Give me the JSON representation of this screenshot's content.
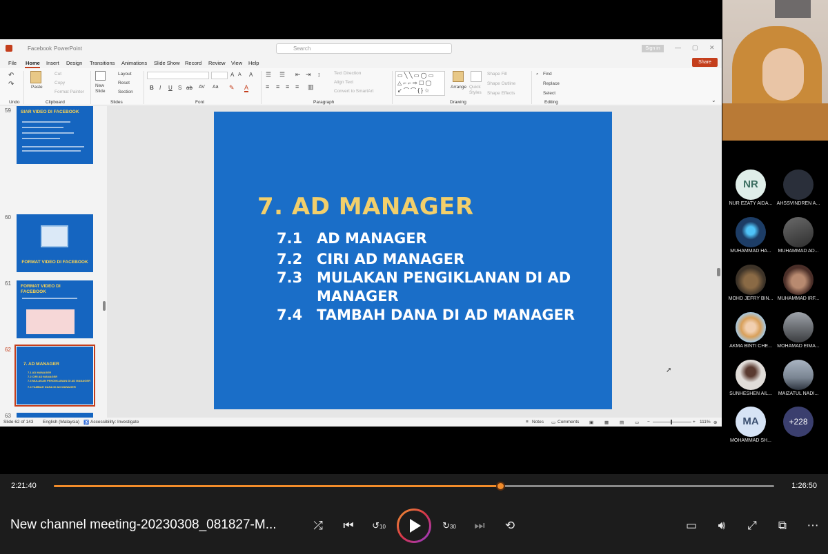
{
  "ppt": {
    "app": "PowerPoint",
    "file_name": "Facebook",
    "search_placeholder": "Search",
    "sign_in": "Sign in",
    "share": "Share",
    "menu": [
      "File",
      "Home",
      "Insert",
      "Design",
      "Transitions",
      "Animations",
      "Slide Show",
      "Record",
      "Review",
      "View",
      "Help"
    ],
    "ribbon": {
      "undo": "Undo",
      "clipboard": "Clipboard",
      "paste": "Paste",
      "cut": "Cut",
      "copy": "Copy",
      "format_painter": "Format Painter",
      "slides": "Slides",
      "new_slide": "New Slide",
      "layout": "Layout",
      "reset": "Reset",
      "section": "Section",
      "font": "Font",
      "paragraph": "Paragraph",
      "text_direction": "Text Direction",
      "align_text": "Align Text",
      "convert_smartart": "Convert to SmartArt",
      "drawing": "Drawing",
      "arrange": "Arrange",
      "quick_styles": "Quick Styles",
      "shape_fill": "Shape Fill",
      "shape_outline": "Shape Outline",
      "shape_effects": "Shape Effects",
      "editing": "Editing",
      "find": "Find",
      "replace": "Replace",
      "select": "Select"
    },
    "thumbnails": [
      {
        "num": "59",
        "title": "SIAR VIDEO DI FACEBOOK"
      },
      {
        "num": "60",
        "title": "FORMAT VIDEO DI FACEBOOK"
      },
      {
        "num": "61",
        "title": "FORMAT VIDEO DI FACEBOOK"
      },
      {
        "num": "62",
        "title": "7. AD MANAGER",
        "items": [
          "7.1    AD MANAGER",
          "7.2    CIRI AD MANAGER",
          "7.3    MULAKAN PENGIKLANAN DI AD MANAGER",
          "7.4    TAMBAH DANA DI AD MANAGER"
        ]
      },
      {
        "num": "63",
        "title": ""
      }
    ],
    "slide": {
      "title": "7. AD MANAGER",
      "items": [
        {
          "num": "7.1",
          "text": "AD MANAGER"
        },
        {
          "num": "7.2",
          "text": "CIRI AD MANAGER"
        },
        {
          "num": "7.3",
          "text": "MULAKAN PENGIKLANAN DI AD",
          "text2": "MANAGER"
        },
        {
          "num": "7.4",
          "text": "TAMBAH DANA DI AD MANAGER"
        }
      ]
    },
    "status": {
      "slide_count": "Slide 62 of 143",
      "language": "English (Malaysia)",
      "accessibility": "Accessibility: Investigate",
      "notes": "Notes",
      "comments": "Comments",
      "zoom": "111%"
    }
  },
  "participants": [
    {
      "initials": "NR",
      "name": "NUR EZATY AIDA...",
      "color": "#dfeee9"
    },
    {
      "initials": "",
      "name": "AHSSVINDREN A...",
      "color": "#2a2f3a"
    },
    {
      "initials": "",
      "name": "MUHAMMAD HA...",
      "color": "#1d3d66"
    },
    {
      "initials": "",
      "name": "MUHAMMAD AD...",
      "color": "#4a4a4a"
    },
    {
      "initials": "",
      "name": "MOHD JEFRY BIN...",
      "color": "#6b5a3a"
    },
    {
      "initials": "",
      "name": "MUHAMMAD IRF...",
      "color": "#5a3d33"
    },
    {
      "initials": "",
      "name": "AKMA BINTI CHE...",
      "color": "#d9a05a"
    },
    {
      "initials": "",
      "name": "MOHAMAD EIMA...",
      "color": "#5b5e63"
    },
    {
      "initials": "",
      "name": "SUNHESHEN A/L...",
      "color": "#b3aaa4"
    },
    {
      "initials": "",
      "name": "MAIZATUL NADI...",
      "color": "#7a8592"
    },
    {
      "initials": "MA",
      "name": "MOHAMMAD SH...",
      "color": "#d6e3f5"
    },
    {
      "initials": "+228",
      "name": "",
      "color": "#3b3f6e"
    }
  ],
  "player": {
    "current_time": "2:21:40",
    "remaining_time": "1:26:50",
    "progress": 0.62,
    "title": "New channel meeting-20230308_081827-M...",
    "skip_back": "10",
    "skip_forward": "30",
    "accent": "#f28c2a"
  }
}
